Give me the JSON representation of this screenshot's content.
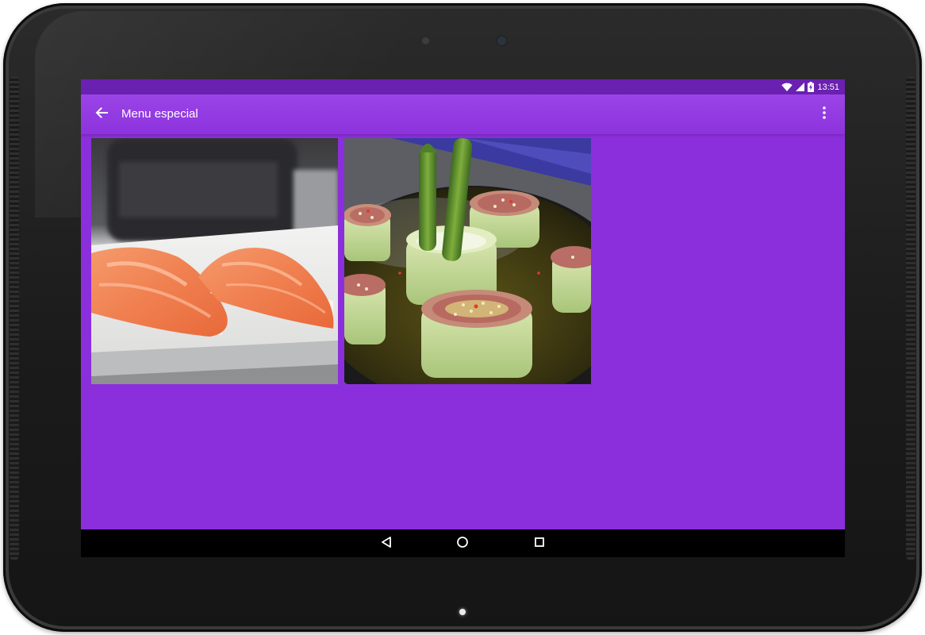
{
  "app": {
    "title": "Menu especial"
  },
  "status_bar": {
    "time": "13:51",
    "icons": [
      "wifi-icon",
      "cell-signal-icon",
      "battery-charging-icon"
    ]
  },
  "toolbar": {
    "back_icon": "arrow-back-icon",
    "overflow_icon": "more-vert-icon"
  },
  "gallery": {
    "items": [
      {
        "image": "salmon-nigiri-photo"
      },
      {
        "image": "cucumber-rolls-asparagus-photo"
      }
    ]
  },
  "nav_bar": {
    "icons": [
      "nav-back-icon",
      "nav-home-icon",
      "nav-recents-icon"
    ]
  },
  "colors": {
    "primary": "#8b2fdc",
    "primary_dark": "#6a20b0",
    "toolbar": "#9a44e6",
    "nav_bar": "#000000"
  }
}
